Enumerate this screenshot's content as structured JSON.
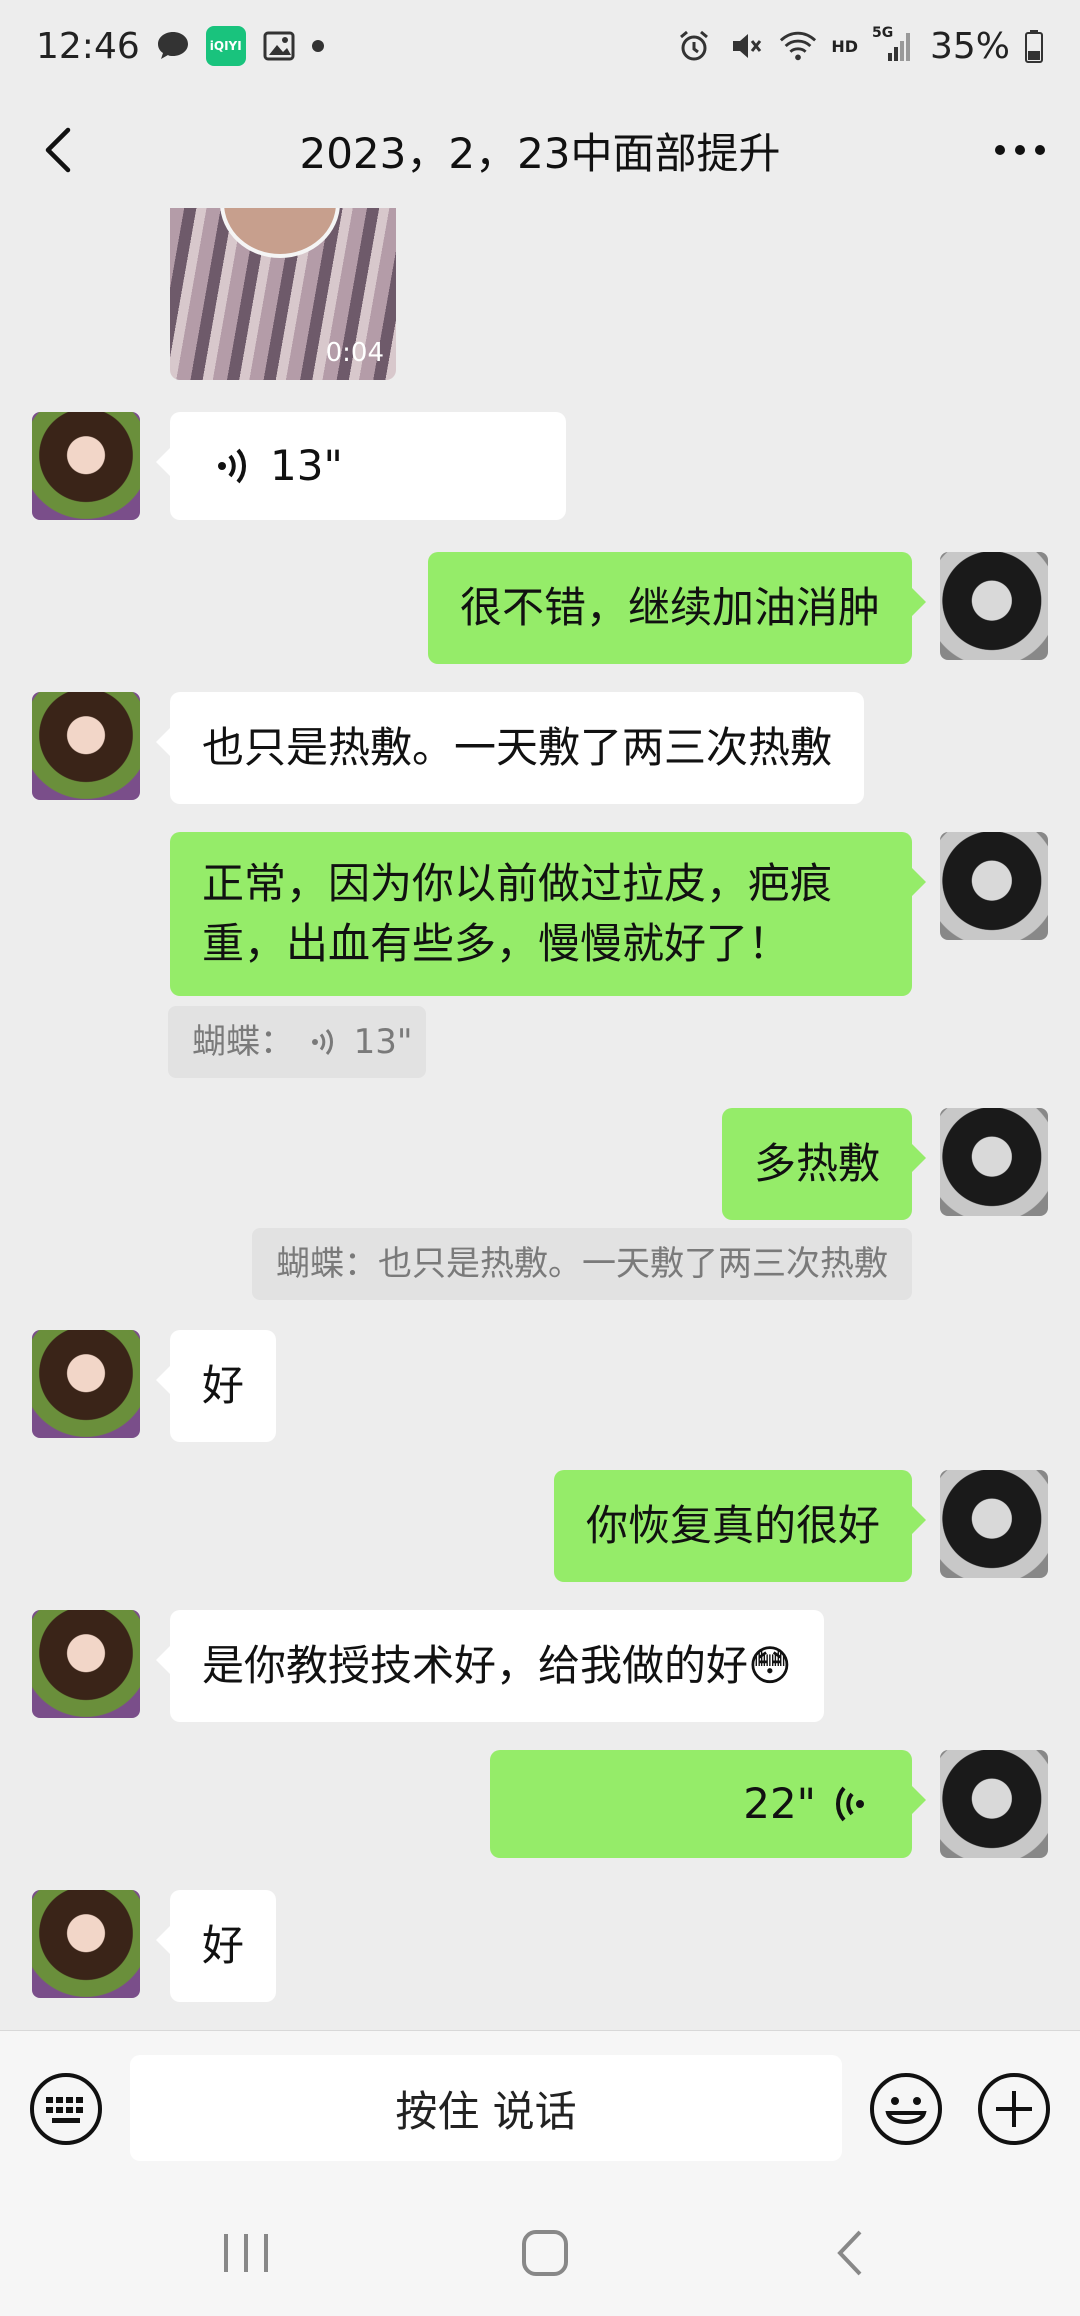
{
  "status_bar": {
    "time": "12:46",
    "app_icon_label": "iQIYI",
    "network": "HD",
    "signal_label": "5G",
    "battery": "35%",
    "icons": [
      "chat-bubble-icon",
      "iqiyi-icon",
      "gallery-icon",
      "dot-icon",
      "alarm-icon",
      "mute-icon",
      "wifi-icon",
      "signal-icon",
      "battery-icon"
    ]
  },
  "header": {
    "title": "2023，2，23中面部提升",
    "back_icon": "chevron-left-icon",
    "more_icon": "more-dots-icon"
  },
  "messages": {
    "video": {
      "duration": "0:04"
    },
    "m1": {
      "side": "left",
      "type": "voice",
      "duration": "13\""
    },
    "m2": {
      "side": "right",
      "text": "很不错，继续加油消肿"
    },
    "m3": {
      "side": "left",
      "text": "也只是热敷。一天敷了两三次热敷"
    },
    "m4": {
      "side": "right",
      "line1": "正常，因为你以前做过拉皮，疤痕",
      "line2": "重，出血有些多，慢慢就好了！",
      "quote_sender": "蝴蝶：",
      "quote_duration": "13\""
    },
    "m5": {
      "side": "right",
      "text": "多热敷",
      "quote": "蝴蝶：也只是热敷。一天敷了两三次热敷"
    },
    "m6": {
      "side": "left",
      "text": "好"
    },
    "m7": {
      "side": "right",
      "text": "你恢复真的很好"
    },
    "m8": {
      "side": "left",
      "text": "是你教授技术好，给我做的好",
      "emoji": "😳"
    },
    "m9": {
      "side": "right",
      "type": "voice",
      "duration": "22\""
    },
    "m10": {
      "side": "left",
      "text": "好"
    }
  },
  "input_bar": {
    "hold_to_talk": "按住 说话",
    "icons": [
      "keyboard-icon",
      "emoji-icon",
      "plus-icon"
    ]
  },
  "nav_bar": {
    "icons": [
      "recents-icon",
      "home-icon",
      "back-icon"
    ]
  },
  "colors": {
    "background": "#ededed",
    "bubble_sent": "#95ec69",
    "bubble_received": "#ffffff",
    "quote_bg": "#e2e2e2"
  }
}
